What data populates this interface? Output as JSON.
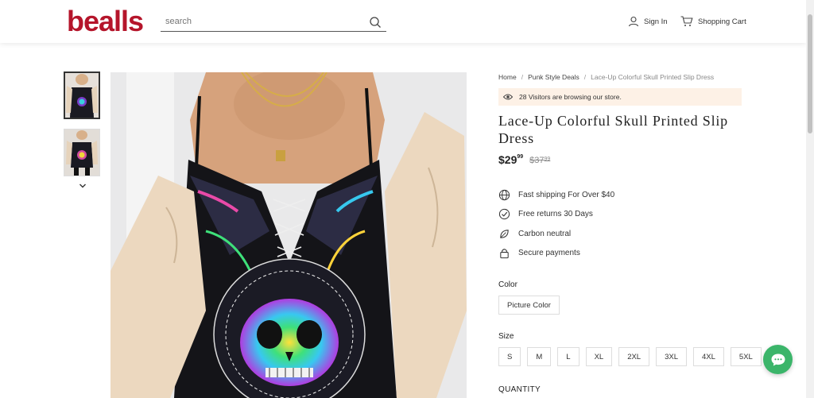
{
  "header": {
    "logo": "bealls",
    "search_placeholder": "search",
    "signin_label": "Sign In",
    "cart_label": "Shopping Cart"
  },
  "breadcrumb": {
    "home": "Home",
    "category": "Punk Style Deals",
    "current": "Lace-Up Colorful Skull Printed Slip Dress"
  },
  "visitors_text": "28 Visitors are browsing our store.",
  "product": {
    "title": "Lace-Up Colorful Skull Printed Slip Dress",
    "price_main": "$29",
    "price_cents": "99",
    "old_price_main": "$37",
    "old_price_cents": "99"
  },
  "features": [
    {
      "icon": "globe-icon",
      "label": "Fast shipping For Over $40"
    },
    {
      "icon": "check-circle-icon",
      "label": "Free returns 30 Days"
    },
    {
      "icon": "leaf-icon",
      "label": "Carbon neutral"
    },
    {
      "icon": "lock-icon",
      "label": "Secure payments"
    }
  ],
  "color": {
    "label": "Color",
    "options": [
      "Picture Color"
    ]
  },
  "size": {
    "label": "Size",
    "options": [
      "S",
      "M",
      "L",
      "XL",
      "2XL",
      "3XL",
      "4XL",
      "5XL"
    ]
  },
  "quantity_label": "QUANTITY",
  "colors": {
    "brand": "#b5152b",
    "chat": "#3bb56a",
    "visitors_bg": "#fdf1e6"
  }
}
